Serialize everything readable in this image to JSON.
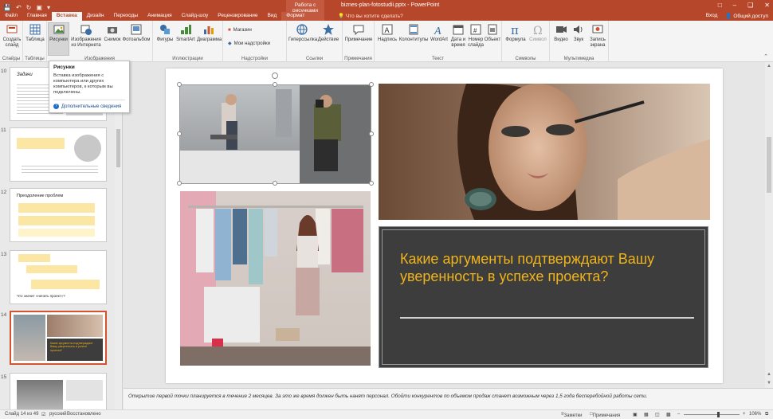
{
  "title_bar": {
    "context_tab_title": "Работа с рисунками",
    "document_title": "biznes-plan-fotostudii.pptx - PowerPoint",
    "tell_me": "Что вы хотите сделать?",
    "share": "Общий доступ",
    "sign_in": "Вход"
  },
  "tabs": [
    {
      "label": "Файл",
      "active": false
    },
    {
      "label": "Главная",
      "active": false
    },
    {
      "label": "Вставка",
      "active": true
    },
    {
      "label": "Дизайн",
      "active": false
    },
    {
      "label": "Переходы",
      "active": false
    },
    {
      "label": "Анимация",
      "active": false
    },
    {
      "label": "Слайд-шоу",
      "active": false
    },
    {
      "label": "Рецензирование",
      "active": false
    },
    {
      "label": "Вид",
      "active": false
    },
    {
      "label": "Формат",
      "active": false,
      "contextual": true
    }
  ],
  "ribbon": {
    "new_slide": "Создать слайд",
    "table": "Таблица",
    "pictures": "Рисунки",
    "online_pictures": "Изображения из Интернета",
    "screenshot": "Снимок",
    "photo_album": "Фотоальбом",
    "shapes": "Фигуры",
    "smartart": "SmartArt",
    "chart": "Диаграмма",
    "store": "Магазин",
    "my_addins": "Мои надстройки",
    "hyperlink": "Гиперссылка",
    "action": "Действие",
    "comment": "Примечание",
    "textbox": "Надпись",
    "header_footer": "Колонтитулы",
    "wordart": "WordArt",
    "date_time": "Дата и время",
    "slide_number": "Номер слайда",
    "object": "Объект",
    "equation": "Формула",
    "symbol": "Символ",
    "video": "Видео",
    "audio": "Звук",
    "screen_recording": "Запись экрана",
    "groups": {
      "slides": "Слайды",
      "tables": "Таблицы",
      "images": "Изображения",
      "illustrations": "Иллюстрации",
      "addins": "Надстройки",
      "links": "Ссылки",
      "comments": "Примечания",
      "text": "Текст",
      "symbols": "Символы",
      "media": "Мультимедиа"
    }
  },
  "tooltip": {
    "title": "Рисунки",
    "body": "Вставка изображения с компьютера или других компьютеров, к которым вы подключены.",
    "link": "Дополнительные сведения"
  },
  "thumbnails": [
    {
      "number": "10",
      "heading": "Задачи"
    },
    {
      "number": "11",
      "heading": ""
    },
    {
      "number": "12",
      "heading": "Преодоление проблем"
    },
    {
      "number": "13",
      "heading": "Что значит «начать проект»?"
    },
    {
      "number": "14",
      "heading": "Какие аргументы подтверждают Вашу уверенность в успехе проекта?",
      "selected": true
    },
    {
      "number": "15",
      "heading": ""
    }
  ],
  "slide": {
    "question": "Какие аргументы подтверждают Вашу уверенность в успехе проекта?",
    "accent_color": "#f0b419"
  },
  "notes": {
    "text": "Открытие первой точки планируется в течение 2 месяцев. За это же время должен быть нанят персонал. Обойти конкурентов по объемом продаж станет возможным через 1,5 года бесперебойной работы сети."
  },
  "status_bar": {
    "slide_position": "Слайд 14 из 49",
    "language": "русский",
    "recovered": "Восстановлено",
    "notes": "Заметки",
    "comments": "Примечания",
    "zoom": "106%"
  },
  "colors": {
    "brand": "#b7472a",
    "selection": "#d35230"
  }
}
